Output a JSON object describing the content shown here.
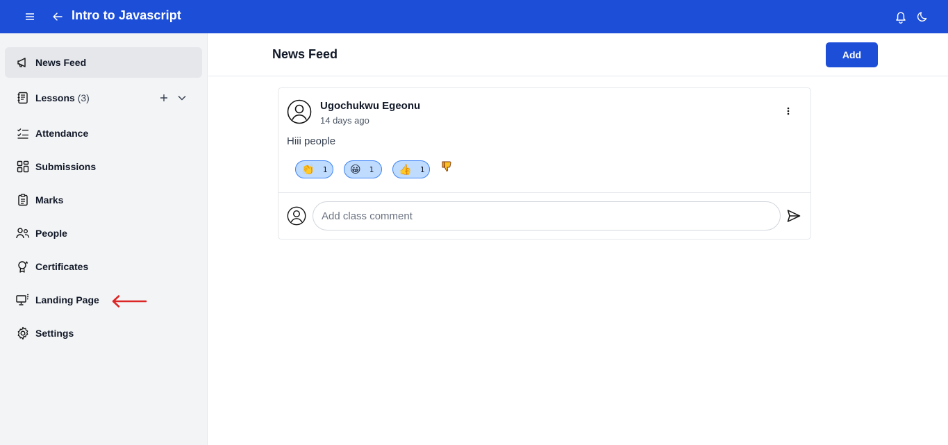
{
  "header": {
    "title": "Intro to Javascript",
    "icons": [
      "menu-icon",
      "back-arrow-icon",
      "bell-icon",
      "moon-icon"
    ],
    "color": "#1d4ed8"
  },
  "sidebar": {
    "items": [
      {
        "label": "News Feed",
        "icon": "megaphone-icon",
        "active": true
      },
      {
        "label": "Lessons",
        "count": "(3)",
        "icon": "lessons-icon"
      },
      {
        "label": "Attendance",
        "icon": "checklist-icon"
      },
      {
        "label": "Submissions",
        "icon": "grid-icon"
      },
      {
        "label": "Marks",
        "icon": "clipboard-icon"
      },
      {
        "label": "People",
        "icon": "people-icon"
      },
      {
        "label": "Certificates",
        "icon": "certificate-icon"
      },
      {
        "label": "Landing Page",
        "icon": "monitor-icon"
      },
      {
        "label": "Settings",
        "icon": "gear-icon"
      }
    ]
  },
  "main": {
    "title": "News Feed",
    "add_label": "Add",
    "post": {
      "author": "Ugochukwu Egeonu",
      "time": "14 days ago",
      "body": "Hiii people",
      "reactions": [
        {
          "emoji": "👏",
          "count": "1"
        },
        {
          "emoji": "😀",
          "count": "1"
        },
        {
          "emoji": "👍",
          "count": "1"
        }
      ],
      "comment_placeholder": "Add class comment"
    }
  }
}
